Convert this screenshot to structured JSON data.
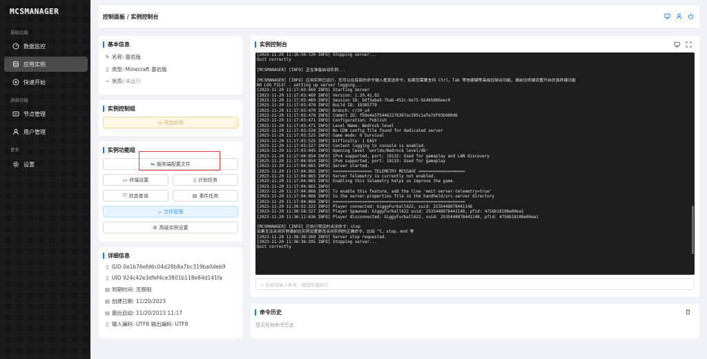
{
  "app": {
    "logo": "MCSMANAGER"
  },
  "sidebar": {
    "groups": {
      "basic": "基础功能",
      "advanced": "高级功能",
      "more": "更多"
    },
    "items": [
      {
        "label": "数据监控",
        "icon": "dashboard-icon"
      },
      {
        "label": "应用实例",
        "icon": "database-icon",
        "active": true
      },
      {
        "label": "快速开始",
        "icon": "plus-circle-icon"
      },
      {
        "label": "节点管理",
        "icon": "node-icon"
      },
      {
        "label": "用户管理",
        "icon": "user-icon"
      },
      {
        "label": "设置",
        "icon": "gear-icon"
      }
    ]
  },
  "header": {
    "breadcrumb": "控制面板 / 实例控制台"
  },
  "basic_info": {
    "title": "基本信息",
    "name_label": "名称:",
    "name_value": "基岩版",
    "type_label": "类型:",
    "type_value": "Minecraft 基岩版",
    "status_label": "状态:",
    "status_value": "未运行"
  },
  "control_group": {
    "title": "实例控制组",
    "start_button": "开启实例"
  },
  "function_group": {
    "title": "实例功能组",
    "server_config": "服务端配置文件",
    "terminal_settings": "终端设置",
    "scheduled_tasks": "计划任务",
    "status_query": "状态查询",
    "event_tasks": "事件任务",
    "file_management": "文件管理",
    "advanced_settings": "高级实例设置"
  },
  "details": {
    "title": "详细信息",
    "gid": "GID 0e1b76efd6c04d28b8a7bc319ba0deb9",
    "uid": "UID 924c42e3dfef4ce3801b118e84d141fa",
    "expire": "到期时间: 无限制",
    "created": "创建日期: 11/20/2023",
    "last_start": "最后启动: 11/20/2023 11:17",
    "encoding": "输入编码: UTF8 输出编码: UTF8"
  },
  "console": {
    "title": "实例控制台",
    "lines": [
      "[2023-11-20 11:16:50:720 INFO] Stopping server...",
      "Quit correctly",
      "",
      "[MCSMANAGER] [INFO] 正在准备启动实例...",
      "",
      "[MCSMANAGER] [INFO] 应用实例已运行，您可以在底部的命令输入框发送命令，如果您需要支持 Ctrl，Tab 等快捷键等高级控制台功能，请前往终端设置开启仿真终端功能",
      "NO LOG FILE! - setting up server logging...",
      "[2023-11-20 11:17:03:469 INFO] Starting Server",
      "[2023-11-20 11:17:03:469 INFO] Version: 1.20.41.02",
      "[2023-11-20 11:17:03:469 INFO] Session ID: bdf3aba5-7bab-452c-be75-924b5886eec9",
      "[2023-11-20 11:17:03:470 INFO] Build ID: 19385779",
      "[2023-11-20 11:17:03:470 INFO] Branch: r/20_u4",
      "[2023-11-20 11:17:03:470 INFO] Commit ID: fb9e4a5f54462276397ac295c1afe7df03b900d6",
      "[2023-11-20 11:17:03:471 INFO] Configuration: Publish",
      "[2023-11-20 11:17:03:471 INFO] Level Name: Bedrock level",
      "[2023-11-20 11:17:03:524 INFO] No CDN config file found for dedicated server",
      "[2023-11-20 11:17:03:525 INFO] Game mode: 0 Survival",
      "[2023-11-20 11:17:03:525 INFO] Difficulty: 1 EASY",
      "[2023-11-20 11:17:03:527 INFO] Content logging to console is enabled.",
      "[2023-11-20 11:17:03:045 INFO] Opening level 'worlds/Bedrock level/db'",
      "[2023-11-20 11:17:04:854 INFO] IPv4 supported, port: 19132: Used for gameplay and LAN discovery",
      "[2023-11-20 11:17:04:854 INFO] IPv6 supported, port: 19133: Used for gameplay",
      "[2023-11-20 11:17:04:865 INFO] Server started.",
      "[2023-11-20 11:17:04:865 INFO] ================ TELEMETRY MESSAGE ===================",
      "[2023-11-20 11:17:04:865 INFO] Server Telemetry is currently not enabled.",
      "[2023-11-20 11:17:04:865 INFO] Enabling this telemetry helps us improve the game.",
      "[2023-11-20 11:17:04:865 INFO]",
      "[2023-11-20 11:17:04:866 INFO] To enable this feature, add the line 'emit-server-telemetry=true'",
      "[2023-11-20 11:17:04:866 INFO] to the server.properties file in the handheld/src-server directory",
      "[2023-11-20 11:17:04:866 INFO] ======================================================",
      "[2023-11-20 11:30:52:322 INFO] Player connected: GiggyFurball622, xuid: 2535448078441148",
      "[2023-11-20 11:30:58:327 INFO] Player Spawned: GiggyFurball622 xuid: 2535448078441148, pfid: 4756b18106e00ea1",
      "[2023-11-20 11:36:11:636 INFO] Player disconnected: GiggyFurball622, xuid: 2535448078441148, pfid: 4756b18108e00ea1",
      "",
      "[MCSMANAGER] [INFO] 已执行预设的关闭命令：stop",
      "如果无法关闭实例请前往实例设置更改关闭实例的正确命令，比如 ^C，stop，end 等",
      "[2023-11-20 11:36:36:269 INFO] Server stop requested.",
      "[2023-11-20 11:36:36:295 INFO] Stopping server...",
      "Quit correctly"
    ],
    "input_placeholder": "> 此处可输入命令，按回车键执行"
  },
  "history": {
    "title": "命令历史",
    "empty": "暂无任何命令历史"
  }
}
